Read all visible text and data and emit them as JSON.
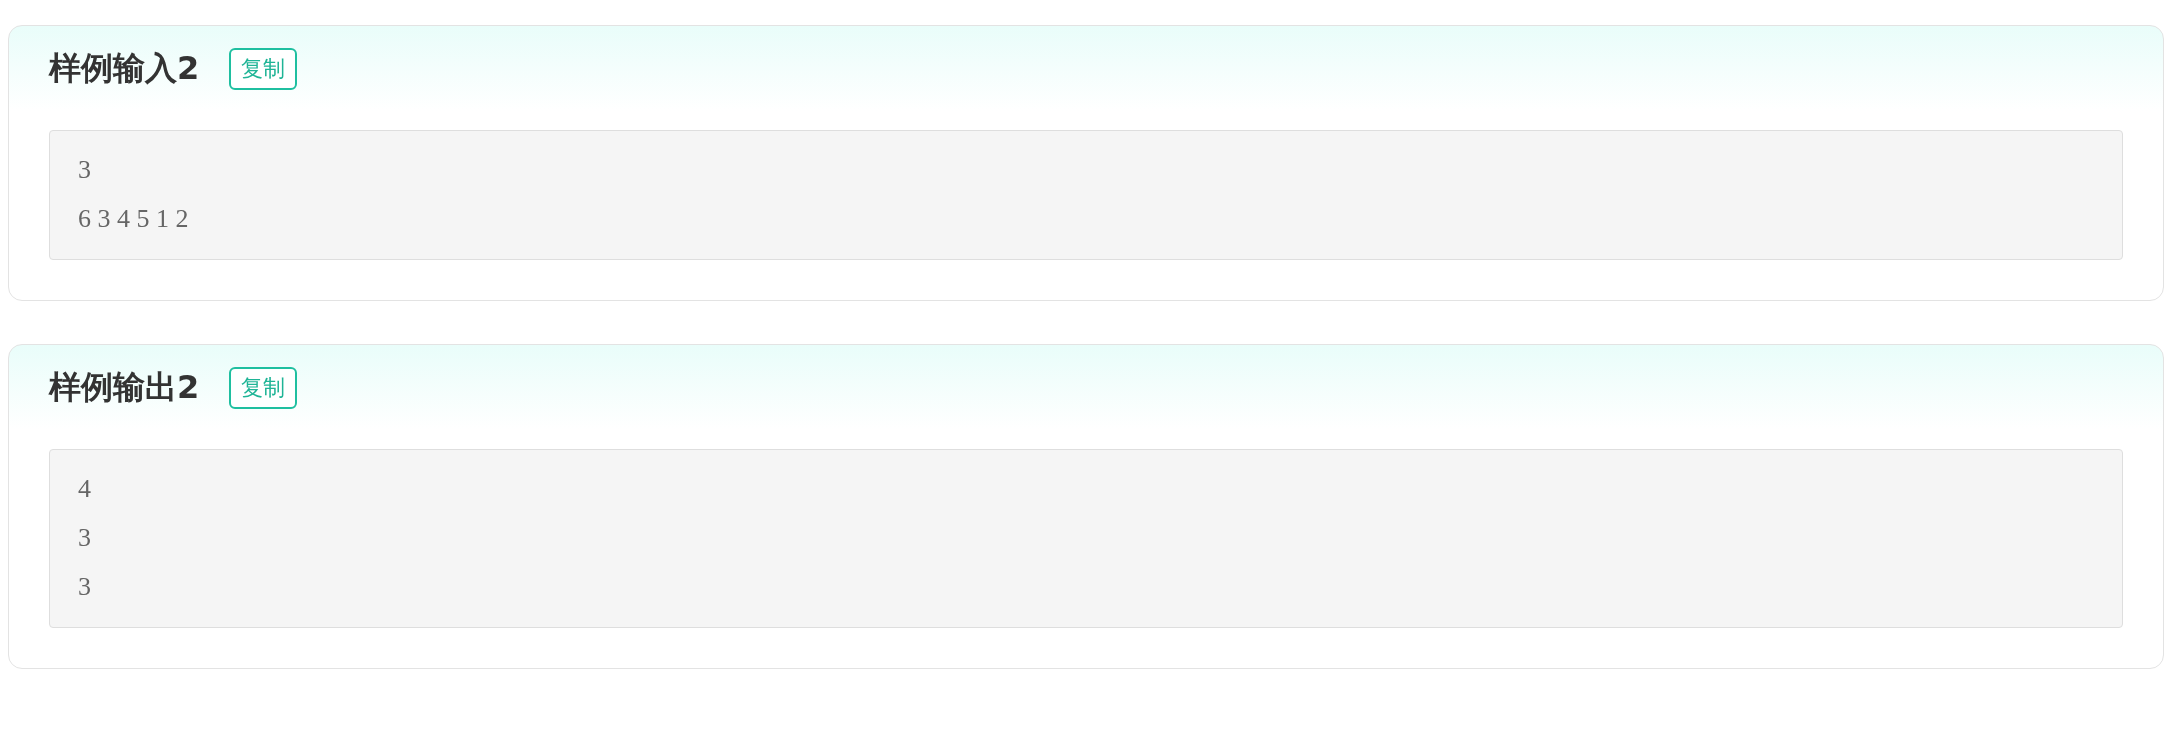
{
  "samples": [
    {
      "title": "样例输入2",
      "copy_button": "复制",
      "lines": [
        "3",
        "6 3 4 5 1 2"
      ]
    },
    {
      "title": "样例输出2",
      "copy_button": "复制",
      "lines": [
        "4",
        "3",
        "3"
      ]
    }
  ]
}
